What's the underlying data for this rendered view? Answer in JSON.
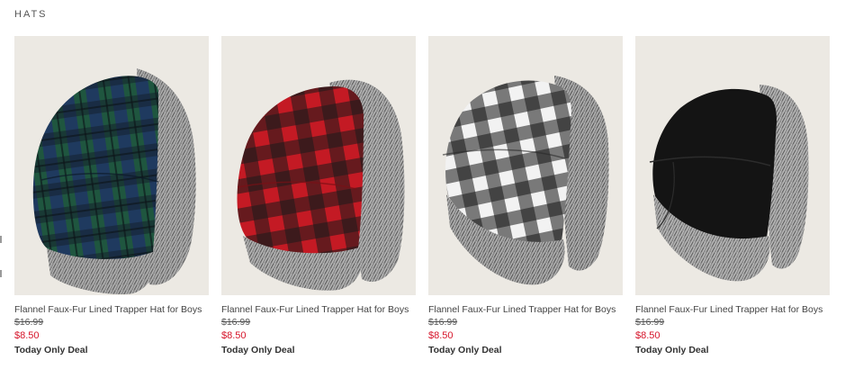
{
  "section": {
    "title": "HATS"
  },
  "products": [
    {
      "name": "Flannel Faux-Fur Lined Trapper Hat for Boys",
      "original_price": "$16.99",
      "sale_price": "$8.50",
      "deal": "Today Only Deal",
      "image": {
        "pattern": "tartan-plaid",
        "colors": [
          "#1f3a5f",
          "#1f5a3a",
          "#14202e"
        ]
      }
    },
    {
      "name": "Flannel Faux-Fur Lined Trapper Hat for Boys",
      "original_price": "$16.99",
      "sale_price": "$8.50",
      "deal": "Today Only Deal",
      "image": {
        "pattern": "buffalo-check",
        "colors": [
          "#c41a24",
          "#1a1a1a"
        ]
      }
    },
    {
      "name": "Flannel Faux-Fur Lined Trapper Hat for Boys",
      "original_price": "$16.99",
      "sale_price": "$8.50",
      "deal": "Today Only Deal",
      "image": {
        "pattern": "buffalo-check",
        "colors": [
          "#f2f2f2",
          "#151515"
        ]
      }
    },
    {
      "name": "Flannel Faux-Fur Lined Trapper Hat for Boys",
      "original_price": "$16.99",
      "sale_price": "$8.50",
      "deal": "Today Only Deal",
      "image": {
        "pattern": "solid",
        "colors": [
          "#141414"
        ]
      }
    }
  ],
  "colors": {
    "sale_price": "#d6152a",
    "image_background": "#ece9e3",
    "fur": "#8c8c8c"
  }
}
